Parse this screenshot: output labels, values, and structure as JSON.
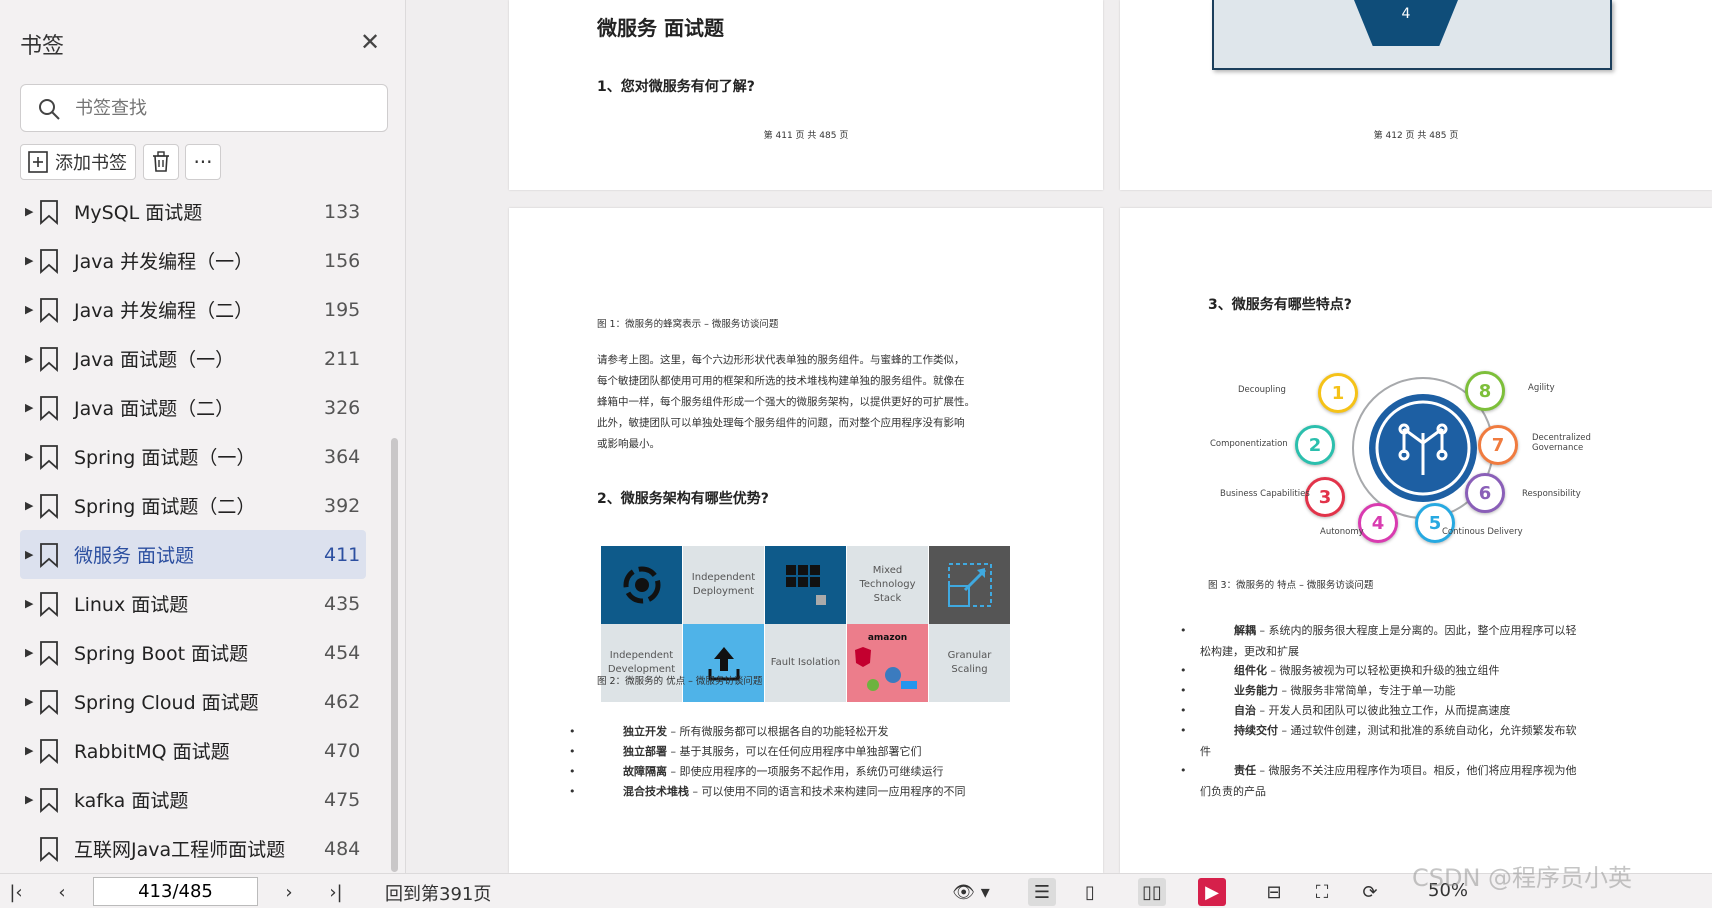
{
  "sidebar": {
    "title": "书签",
    "search_placeholder": "书签查找",
    "add_label": "添加书签",
    "items": [
      {
        "label": "MySQL 面试题",
        "page": "133"
      },
      {
        "label": "Java 并发编程（一）",
        "page": "156"
      },
      {
        "label": "Java 并发编程（二）",
        "page": "195"
      },
      {
        "label": "Java 面试题（一）",
        "page": "211"
      },
      {
        "label": "Java 面试题（二）",
        "page": "326"
      },
      {
        "label": "Spring 面试题（一）",
        "page": "364"
      },
      {
        "label": "Spring 面试题（二）",
        "page": "392"
      },
      {
        "label": "微服务 面试题",
        "page": "411"
      },
      {
        "label": "Linux 面试题",
        "page": "435"
      },
      {
        "label": "Spring Boot 面试题",
        "page": "454"
      },
      {
        "label": "Spring Cloud 面试题",
        "page": "462"
      },
      {
        "label": "RabbitMQ 面试题",
        "page": "470"
      },
      {
        "label": "kafka 面试题",
        "page": "475"
      },
      {
        "label": "互联网Java工程师面试题",
        "page": "484"
      }
    ]
  },
  "page411": {
    "title": "微服务  面试题",
    "question": "1、您对微服务有何了解?",
    "footer": "第 411 页 共 485 页"
  },
  "page412": {
    "hex_number": "4",
    "footer": "第 412 页 共 485 页"
  },
  "page413": {
    "fig1_caption": "图 1：微服务的蜂窝表示 – 微服务访谈问题",
    "para_lines": [
      "请参考上图。这里，每个六边形形状代表单独的服务组件。与蜜蜂的工作类似，",
      "每个敏捷团队都使用可用的框架和所选的技术堆栈构建单独的服务组件。就像在",
      "蜂箱中一样，每个服务组件形成一个强大的微服务架构，以提供更好的可扩展性。",
      "此外，敏捷团队可以单独处理每个服务组件的问题，而对整个应用程序没有影响",
      "或影响最小。"
    ],
    "question": "2、微服务架构有哪些优势?",
    "grid": {
      "independent_deployment": "Independent Deployment",
      "mixed_stack": "Mixed Technology Stack",
      "independent_development": "Independent Development",
      "fault_isolation": "Fault Isolation",
      "granular_scaling": "Granular Scaling",
      "amazon": "amazon"
    },
    "fig2_caption": "图 2：微服务的  优点 – 微服务访谈问题",
    "bullets": [
      {
        "bold": "独立开发",
        "text": " – 所有微服务都可以根据各自的功能轻松开发"
      },
      {
        "bold": "独立部署",
        "text": " – 基于其服务，可以在任何应用程序中单独部署它们"
      },
      {
        "bold": "故障隔离",
        "text": " – 即使应用程序的一项服务不起作用，系统仍可继续运行"
      },
      {
        "bold": "混合技术堆栈",
        "text": " – 可以使用不同的语言和技术来构建同一应用程序的不同"
      }
    ]
  },
  "page414": {
    "question": "3、微服务有哪些特点?",
    "features": [
      {
        "n": "1",
        "label": "Decoupling"
      },
      {
        "n": "2",
        "label": "Componentization"
      },
      {
        "n": "3",
        "label": "Business Capabilities"
      },
      {
        "n": "4",
        "label": "Autonomy"
      },
      {
        "n": "5",
        "label": "Continous Delivery"
      },
      {
        "n": "6",
        "label": "Responsibility"
      },
      {
        "n": "7",
        "label": "Decentralized Governance"
      },
      {
        "n": "8",
        "label": "Agility"
      }
    ],
    "fig3_caption": "图 3：微服务的  特点 – 微服务访谈问题",
    "bullets": [
      {
        "bold": "解耦",
        "text": " – 系统内的服务很大程度上是分离的。因此，整个应用程序可以轻",
        "cont": "松构建，更改和扩展"
      },
      {
        "bold": "组件化",
        "text": " – 微服务被视为可以轻松更换和升级的独立组件"
      },
      {
        "bold": "业务能力",
        "text": " – 微服务非常简单，专注于单一功能"
      },
      {
        "bold": "自治",
        "text": " – 开发人员和团队可以彼此独立工作，从而提高速度"
      },
      {
        "bold": "持续交付",
        "text": " – 通过软件创建，测试和批准的系统自动化，允许频繁发布软",
        "cont": "件"
      },
      {
        "bold": "责任",
        "text": " – 微服务不关注应用程序作为项目。相反，他们将应用程序视为他",
        "cont": "们负责的产品"
      }
    ]
  },
  "toolbar": {
    "page_input": "413/485",
    "back_label": "回到第391页",
    "zoom": "50%"
  },
  "watermark": "CSDN @程序员小英",
  "colors": {
    "active_bg": "#dce1ee",
    "active_text": "#2c4fa0",
    "accent_red": "#d6204b"
  }
}
